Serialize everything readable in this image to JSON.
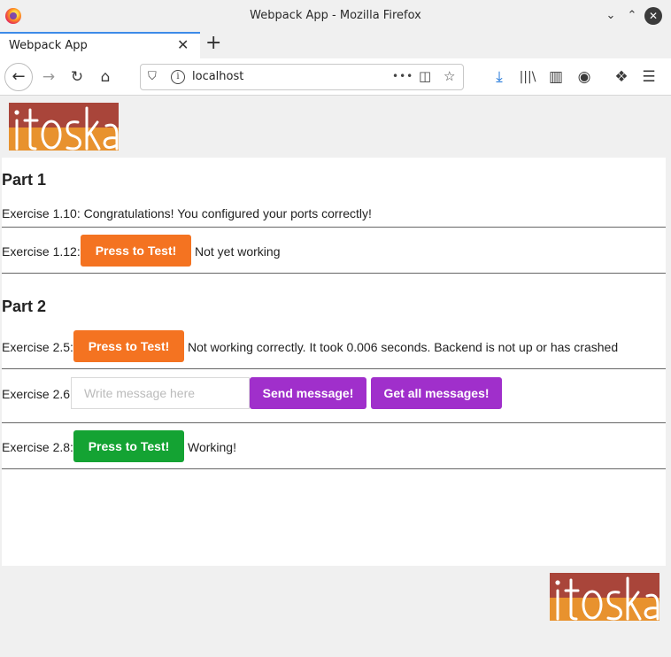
{
  "window": {
    "title": "Webpack App - Mozilla Firefox",
    "controls": {
      "minimize": "⌄",
      "maximize": "⌃",
      "close": "✕"
    }
  },
  "tab": {
    "label": "Webpack App",
    "close": "✕",
    "new_tab": "+"
  },
  "navbar": {
    "url": "localhost",
    "more": "•••",
    "icons": [
      "back-icon",
      "forward-icon",
      "reload-icon",
      "home-icon",
      "shield-icon",
      "info-icon",
      "pocket-icon",
      "bookmark-star-icon",
      "download-icon",
      "library-icon",
      "sidebar-icon",
      "account-icon",
      "extensions-icon",
      "menu-icon"
    ]
  },
  "brand": {
    "logo_text": "itoska",
    "colors": {
      "red": "#a9453a",
      "orange": "#e8922e"
    }
  },
  "part1": {
    "heading": "Part 1",
    "ex110": "Exercise 1.10: Congratulations! You configured your ports correctly!",
    "ex112_label": "Exercise 1.12:",
    "ex112_button": "Press to Test!",
    "ex112_status": "Not yet working"
  },
  "part2": {
    "heading": "Part 2",
    "ex25_label": "Exercise 2.5:",
    "ex25_button": "Press to Test!",
    "ex25_status": "Not working correctly. It took 0.006 seconds. Backend is not up or has crashed",
    "ex26_label": "Exercise 2.6:",
    "ex26_placeholder": "Write message here",
    "ex26_send": "Send message!",
    "ex26_get": "Get all messages!",
    "ex28_label": "Exercise 2.8:",
    "ex28_button": "Press to Test!",
    "ex28_status": "Working!"
  },
  "colors": {
    "orange_button": "#f47321",
    "purple_button": "#a02fcb",
    "green_button": "#14a333",
    "tab_accent": "#3d8be8"
  }
}
